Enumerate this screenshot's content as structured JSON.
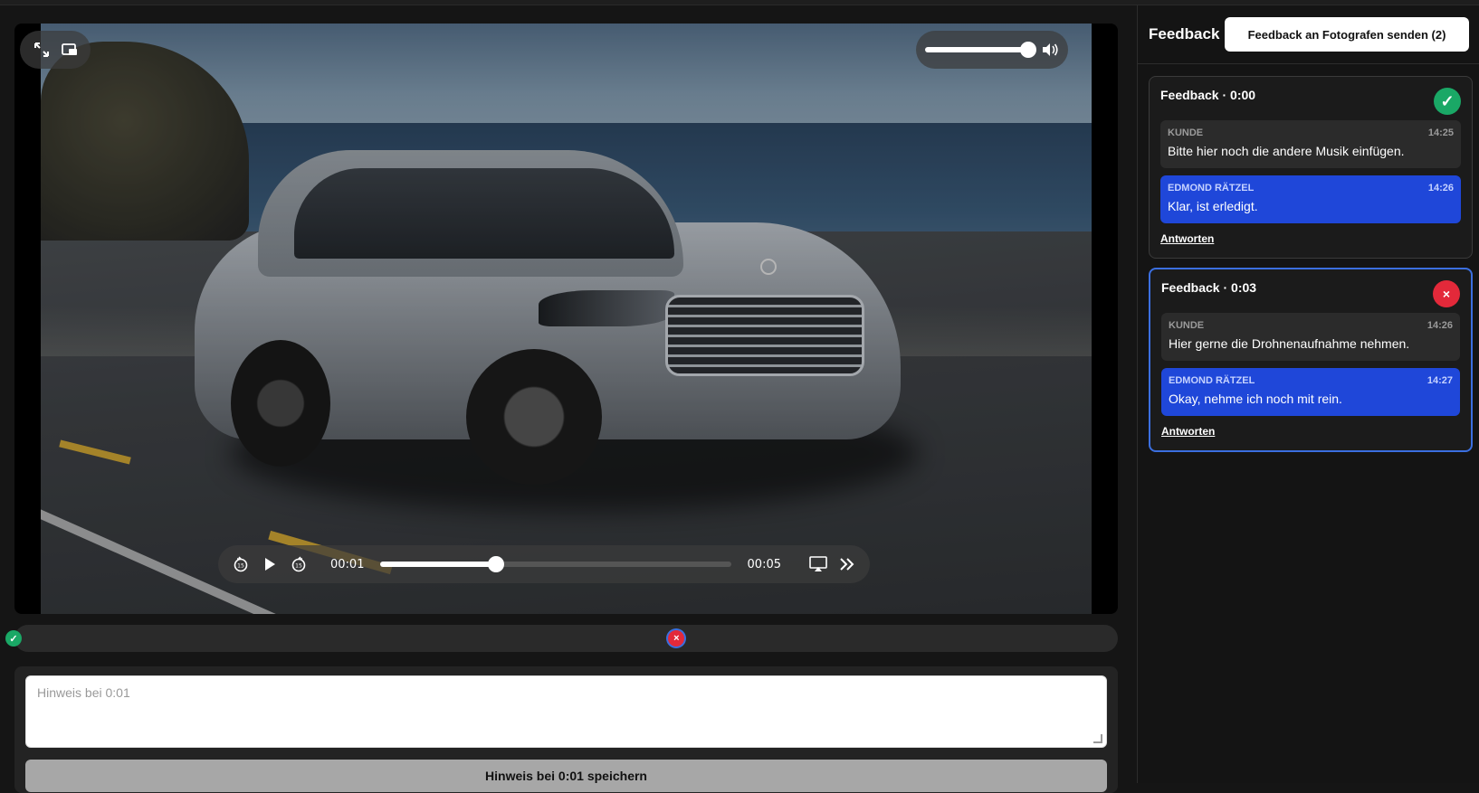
{
  "player": {
    "current_time": "00:01",
    "duration": "00:05",
    "progress_fraction": 0.33,
    "volume_fraction": 0.95,
    "icons": [
      "expand-icon",
      "picture-in-picture-icon",
      "volume-icon",
      "rewind-15-icon",
      "play-icon",
      "forward-15-icon",
      "airplay-icon",
      "skip-forward-icon"
    ]
  },
  "timeline": {
    "markers": [
      {
        "time_fraction": 0.0,
        "status": "ok",
        "symbol": "✓"
      },
      {
        "time_fraction": 0.6,
        "status": "rejected",
        "symbol": "×"
      }
    ]
  },
  "note": {
    "placeholder": "Hinweis bei 0:01",
    "save_label": "Hinweis bei 0:01 speichern"
  },
  "sidebar": {
    "title": "Feedback",
    "send_label": "Feedback an Fotografen senden (2)",
    "cards": [
      {
        "title": "Feedback · 0:00",
        "status": "approved",
        "status_symbol": "✓",
        "messages": [
          {
            "author": "KUNDE",
            "time": "14:25",
            "text": "Bitte hier noch die andere Musik einfügen."
          },
          {
            "author": "EDMOND RÄTZEL",
            "time": "14:26",
            "text": "Klar, ist erledigt."
          }
        ],
        "reply_label": "Antworten"
      },
      {
        "title": "Feedback · 0:03",
        "status": "rejected",
        "status_symbol": "×",
        "messages": [
          {
            "author": "KUNDE",
            "time": "14:26",
            "text": "Hier gerne die Drohnenaufnahme nehmen."
          },
          {
            "author": "EDMOND RÄTZEL",
            "time": "14:27",
            "text": "Okay, nehme ich noch mit rein."
          }
        ],
        "reply_label": "Antworten"
      }
    ]
  },
  "colors": {
    "approved": "#1aa866",
    "rejected": "#e3293a",
    "accent": "#1f47d9"
  }
}
